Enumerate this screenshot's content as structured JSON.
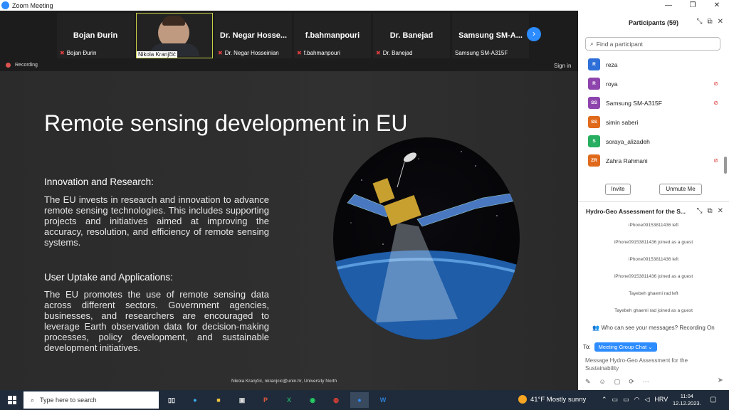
{
  "window": {
    "title": "Zoom Meeting",
    "min": "—",
    "restore": "❐",
    "close": "✕"
  },
  "gallery": {
    "tiles": [
      {
        "big": "Bojan Đurin",
        "small": "Bojan Đurin",
        "muted": true
      },
      {
        "big": "",
        "small": "Nikola Kranjčić",
        "muted": false,
        "video": true
      },
      {
        "big": "Dr. Negar Hosse...",
        "small": "Dr. Negar Hosseinian",
        "muted": true
      },
      {
        "big": "f.bahmanpouri",
        "small": "f.bahmanpouri",
        "muted": true
      },
      {
        "big": "Dr. Banejad",
        "small": "Dr. Banejad",
        "muted": true
      },
      {
        "big": "Samsung SM-A...",
        "small": "Samsung SM-A315F",
        "muted": false
      }
    ],
    "next_icon": "›"
  },
  "status": {
    "recording": "Recording",
    "signin": "Sign in"
  },
  "slide": {
    "title": "Remote sensing development in EU",
    "section1_heading": "Innovation and Research:",
    "section1_body": "The EU invests in research and innovation to advance remote sensing technologies. This includes supporting projects and initiatives aimed at improving the accuracy, resolution, and efficiency of remote sensing systems.",
    "section2_heading": "User Uptake and Applications:",
    "section2_body": "The EU promotes the use of remote sensing data across different sectors. Government agencies, businesses, and researchers are encouraged to leverage Earth observation data for decision-making processes, policy development, and sustainable development initiatives.",
    "footer": "Nikola Kranjčić, nkranjcic@unin.hr, University North"
  },
  "participants": {
    "title": "Participants (59)",
    "search_placeholder": "Find a participant",
    "list": [
      {
        "initials": "R",
        "name": "reza",
        "color": "#2e6fd8",
        "muted": false
      },
      {
        "initials": "R",
        "name": "roya",
        "color": "#8e44ad",
        "muted": true
      },
      {
        "initials": "SS",
        "name": "Samsung SM-A315F",
        "color": "#8e44ad",
        "muted": true
      },
      {
        "initials": "SS",
        "name": "simin saberi",
        "color": "#e06a1b",
        "muted": false
      },
      {
        "initials": "S",
        "name": "soraya_alizadeh",
        "color": "#27ae60",
        "muted": false
      },
      {
        "initials": "ZR",
        "name": "Zahra Rahmani",
        "color": "#e06a1b",
        "muted": true
      }
    ],
    "invite": "Invite",
    "unmute": "Unmute Me"
  },
  "chat": {
    "title": "Hydro-Geo Assessment for the S...",
    "messages": [
      "iPhone09153811436 left",
      "iPhone09153811436 joined as a guest",
      "iPhone09153811436 left",
      "iPhone09153811436 joined as a guest",
      "Tayebeh ghaemi rad left",
      "Tayebeh ghaemi rad joined as a guest"
    ],
    "who_can_see": "Who can see your messages? Recording On",
    "to_label": "To:",
    "to_value": "Meeting Group Chat ⌄",
    "placeholder": "Message Hydro-Geo Assessment for the Sustainability",
    "more": "···"
  },
  "taskbar": {
    "search": "Type here to search",
    "weather": "41°F  Mostly sunny",
    "lang": "HRV",
    "time": "11:04",
    "date": "12.12.2023."
  }
}
